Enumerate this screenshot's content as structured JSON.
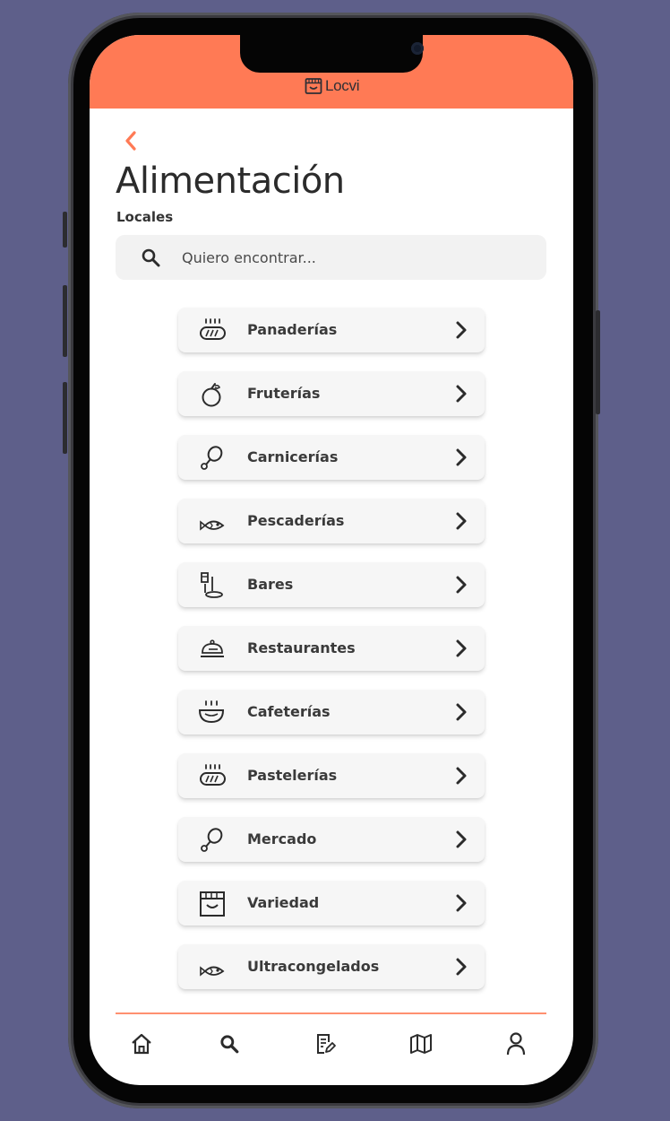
{
  "colors": {
    "background": "#5e5f8a",
    "accent": "#ff7a55",
    "text": "#2b2b2b",
    "card": "#f6f6f6"
  },
  "header": {
    "brand": "Locvi",
    "brand_icon": "shop-icon"
  },
  "page": {
    "title": "Alimentación",
    "subtitle": "Locales",
    "back_icon": "chevron-left-icon"
  },
  "search": {
    "placeholder": "Quiero encontrar...",
    "value": "",
    "icon": "search-icon"
  },
  "categories": [
    {
      "label": "Panaderías",
      "icon": "bread-icon"
    },
    {
      "label": "Fruterías",
      "icon": "apple-icon"
    },
    {
      "label": "Carnicerías",
      "icon": "drumstick-icon"
    },
    {
      "label": "Pescaderías",
      "icon": "fish-icon"
    },
    {
      "label": "Bares",
      "icon": "drinks-icon"
    },
    {
      "label": "Restaurantes",
      "icon": "cloche-icon"
    },
    {
      "label": "Cafeterías",
      "icon": "bowl-icon"
    },
    {
      "label": "Pastelerías",
      "icon": "bread-icon"
    },
    {
      "label": "Mercado",
      "icon": "drumstick-icon"
    },
    {
      "label": "Variedad",
      "icon": "shop-icon"
    },
    {
      "label": "Ultracongelados",
      "icon": "fish-icon"
    }
  ],
  "bottom_nav": [
    {
      "name": "home",
      "icon": "home-icon"
    },
    {
      "name": "search",
      "icon": "search-icon"
    },
    {
      "name": "notes",
      "icon": "edit-document-icon"
    },
    {
      "name": "map",
      "icon": "map-icon"
    },
    {
      "name": "profile",
      "icon": "user-icon"
    }
  ]
}
